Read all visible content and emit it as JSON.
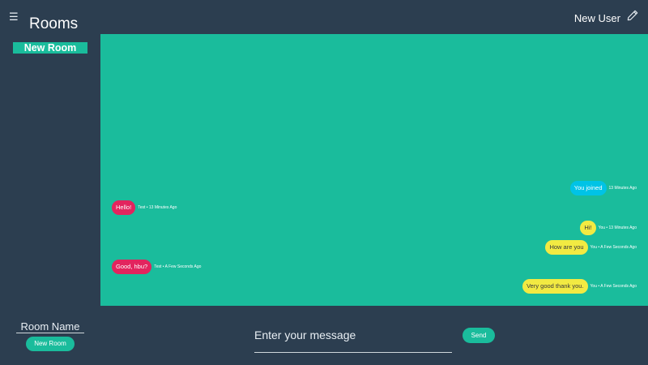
{
  "sidebar": {
    "title": "Rooms",
    "menu_icon": "hamburger-icon",
    "new_room_label": "New Room"
  },
  "header": {
    "user_name": "New User",
    "edit_icon": "pencil-icon"
  },
  "colors": {
    "background": "#2c3e50",
    "accent": "#1abc9c",
    "bubble_self_join": "#00c3e6",
    "bubble_other": "#e2245e",
    "bubble_self": "#f2ea42"
  },
  "messages": [
    {
      "text": "You joined",
      "meta": "13 Minutes Ago"
    },
    {
      "text": "Hello!",
      "meta": "Test • 13 Minutes Ago"
    },
    {
      "text": "Hi!",
      "meta": "You • 13 Minutes Ago"
    },
    {
      "text": "How are you",
      "meta": "You • A Few Seconds Ago"
    },
    {
      "text": "Good, hbu?",
      "meta": "Test • A Few Seconds Ago"
    },
    {
      "text": "Very good thank you.",
      "meta": "You • A Few Seconds Ago"
    }
  ],
  "footer": {
    "room_name_placeholder": "Room Name",
    "new_room_button": "New Room",
    "message_placeholder": "Enter your message",
    "send_button": "Send"
  }
}
